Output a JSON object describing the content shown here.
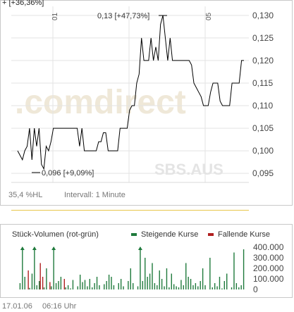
{
  "price_chart": {
    "top_annotation": "+ [+36,36%]",
    "watermark": ".comdirect",
    "watermark2": "SBS.AUS",
    "x_tick_labels": [
      "01",
      "05"
    ],
    "high_label": "0,13 [+47,73%]",
    "low_label": "0,096 [+9,09%]",
    "footer_left": "35,4 %HL",
    "footer_right": "Intervall: 1 Minute",
    "colors": {
      "line": "#000000",
      "grid": "#e3e3e3",
      "watermark": "#e8e8e8",
      "divider": "#e8c64a"
    }
  },
  "volume_chart": {
    "title": "Stück-Volumen (rot-grün)",
    "legend_up": "Steigende Kurse",
    "legend_down": "Fallende Kurse",
    "colors": {
      "up": "#1f7a3c",
      "down": "#b02020"
    }
  },
  "footer": {
    "date": "17.01.06",
    "time": "06:16 Uhr"
  },
  "chart_data": [
    {
      "type": "line",
      "ylim": [
        0.093,
        0.132
      ],
      "yticks": [
        0.095,
        0.1,
        0.105,
        0.11,
        0.115,
        0.12,
        0.125,
        0.13
      ],
      "ytick_labels": [
        "0,095",
        "0,100",
        "0,105",
        "0,110",
        "0,115",
        "0,120",
        "0,125",
        "0,130"
      ],
      "series": [
        {
          "values": [
            0.1,
            0.099,
            0.098,
            0.1,
            0.101,
            0.105,
            0.098,
            0.105,
            0.101,
            0.105,
            0.097,
            0.096,
            0.101,
            0.1,
            0.102,
            0.105,
            0.105,
            0.105,
            0.105,
            0.105,
            0.105,
            0.105,
            0.105,
            0.105,
            0.105,
            0.105,
            0.101,
            0.105,
            0.1,
            0.1,
            0.1,
            0.1,
            0.1,
            0.1,
            0.102,
            0.102,
            0.104,
            0.104,
            0.1,
            0.1,
            0.1,
            0.1,
            0.1,
            0.105,
            0.105,
            0.105,
            0.105,
            0.109,
            0.11,
            0.11,
            0.115,
            0.117,
            0.125,
            0.12,
            0.12,
            0.12,
            0.125,
            0.12,
            0.123,
            0.12,
            0.128,
            0.13,
            0.125,
            0.12,
            0.125,
            0.12,
            0.12,
            0.12,
            0.12,
            0.12,
            0.12,
            0.12,
            0.12,
            0.119,
            0.115,
            0.114,
            0.113,
            0.112,
            0.11,
            0.11,
            0.11,
            0.113,
            0.115,
            0.115,
            0.115,
            0.111,
            0.11,
            0.11,
            0.11,
            0.11,
            0.115,
            0.115,
            0.115,
            0.115,
            0.12,
            0.12
          ]
        }
      ]
    },
    {
      "type": "bar",
      "ylim": [
        0,
        400000
      ],
      "yticks": [
        0,
        100000,
        200000,
        300000,
        400000
      ],
      "ytick_labels": [
        "0",
        "100.000",
        "200.000",
        "300.000",
        "400.000"
      ],
      "series": [
        {
          "values": [
            0,
            60000,
            400000,
            120000,
            0,
            15000,
            150000,
            400000,
            40000,
            80000,
            0,
            20000,
            200000,
            0,
            30000,
            400000,
            60000,
            80000,
            120000,
            0,
            20000,
            40000,
            10000,
            90000,
            0,
            30000,
            140000,
            70000,
            90000,
            30000,
            100000,
            20000,
            60000,
            120000,
            40000,
            0,
            50000,
            80000,
            140000,
            120000,
            40000,
            0,
            60000,
            100000,
            30000,
            0,
            80000,
            200000,
            60000,
            0,
            30000,
            400000,
            80000,
            300000,
            120000,
            150000,
            250000,
            60000,
            40000,
            180000,
            100000,
            30000,
            200000,
            20000,
            150000,
            50000,
            30000,
            20000,
            90000,
            40000,
            250000,
            120000,
            100000,
            40000,
            60000,
            30000,
            80000,
            200000,
            40000,
            0,
            300000,
            20000,
            60000,
            30000,
            120000,
            10000,
            80000,
            150000,
            0,
            20000,
            350000,
            60000,
            20000,
            40000,
            380000,
            0
          ]
        },
        {
          "values": [
            0,
            0,
            0,
            0,
            180000,
            0,
            0,
            0,
            0,
            250000,
            120000,
            0,
            0,
            70000,
            0,
            0,
            0,
            0,
            0,
            100000,
            0,
            0,
            0,
            0,
            0,
            0,
            0,
            0,
            0,
            0,
            0,
            0,
            0,
            0,
            0,
            0,
            0,
            0,
            0,
            0,
            0,
            0,
            0,
            0,
            0,
            0,
            0,
            0,
            0,
            0,
            0,
            0,
            0,
            0,
            0,
            0,
            0,
            0,
            0,
            0,
            0,
            0,
            0,
            0,
            0,
            0,
            0,
            0,
            0,
            0,
            0,
            0,
            0,
            0,
            0,
            0,
            0,
            0,
            0,
            0,
            0,
            0,
            0,
            0,
            0,
            0,
            0,
            0,
            0,
            0,
            0,
            0,
            0,
            0,
            0,
            0
          ]
        }
      ]
    }
  ]
}
